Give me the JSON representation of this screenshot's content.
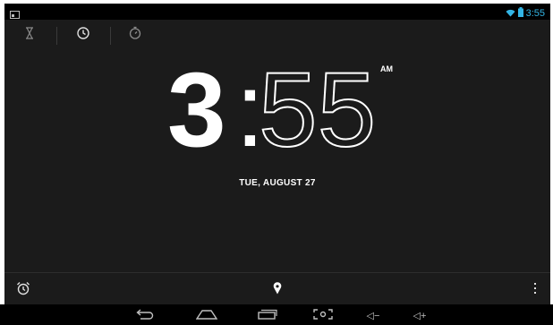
{
  "status_bar": {
    "time": "3:55",
    "icons": [
      "screenshot-icon",
      "wifi-icon",
      "battery-icon"
    ]
  },
  "tabs": [
    {
      "icon": "hourglass-icon",
      "label": ""
    },
    {
      "icon": "clock-icon",
      "label": ""
    },
    {
      "icon": "stopwatch-icon",
      "label": ""
    }
  ],
  "clock": {
    "hour": "3",
    "separator": ":",
    "minutes": "55",
    "ampm": "AM",
    "date": "TUE, AUGUST 27"
  },
  "bottom_bar": {
    "icons": [
      "alarm-icon",
      "location-pin-icon",
      "overflow-menu-icon"
    ]
  },
  "nav_bar": {
    "buttons": [
      "back-icon",
      "home-icon",
      "recent-apps-icon",
      "screenshot-icon",
      "volume-down-icon",
      "volume-up-icon"
    ],
    "vol_down_label": "◁−",
    "vol_up_label": "◁+"
  },
  "colors": {
    "background": "#1b1b1b",
    "accent": "#33b5e5",
    "text": "#ffffff"
  }
}
